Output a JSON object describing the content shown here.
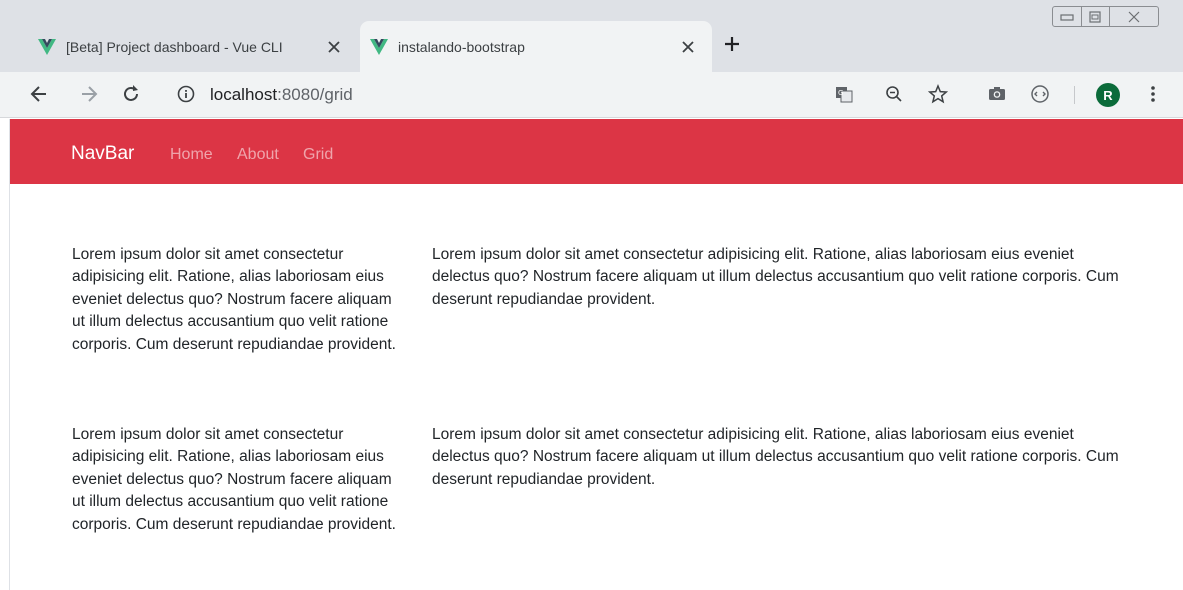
{
  "browser": {
    "tabs": [
      {
        "title": "[Beta] Project dashboard - Vue CLI",
        "active": false
      },
      {
        "title": "instalando-bootstrap",
        "active": true
      }
    ],
    "new_tab_label": "+",
    "address": {
      "host": "localhost",
      "path": ":8080/grid"
    },
    "profile_initial": "R"
  },
  "navbar": {
    "brand": "NavBar",
    "links": [
      "Home",
      "About",
      "Grid"
    ],
    "color": "#dc3545"
  },
  "content": {
    "rows": [
      {
        "left": "Lorem ipsum dolor sit amet consectetur adipisicing elit. Ratione, alias laboriosam eius eveniet delectus quo? Nostrum facere aliquam ut illum delectus accusantium quo velit ratione corporis. Cum deserunt repudiandae provident.",
        "right": "Lorem ipsum dolor sit amet consectetur adipisicing elit. Ratione, alias laboriosam eius eveniet delectus quo? Nostrum facere aliquam ut illum delectus accusantium quo velit ratione corporis. Cum deserunt repudiandae provident."
      },
      {
        "left": "Lorem ipsum dolor sit amet consectetur adipisicing elit. Ratione, alias laboriosam eius eveniet delectus quo? Nostrum facere aliquam ut illum delectus accusantium quo velit ratione corporis. Cum deserunt repudiandae provident.",
        "right": "Lorem ipsum dolor sit amet consectetur adipisicing elit. Ratione, alias laboriosam eius eveniet delectus quo? Nostrum facere aliquam ut illum delectus accusantium quo velit ratione corporis. Cum deserunt repudiandae provident."
      }
    ]
  },
  "icons": {
    "favicon": "vue-logo-icon",
    "back": "arrow-left-icon",
    "forward": "arrow-right-icon",
    "reload": "reload-icon",
    "info": "info-icon",
    "translate": "translate-icon",
    "zoom": "zoom-out-icon",
    "bookmark": "star-icon",
    "screenshot": "camera-icon",
    "extension": "extension-icon",
    "menu": "kebab-menu-icon"
  }
}
